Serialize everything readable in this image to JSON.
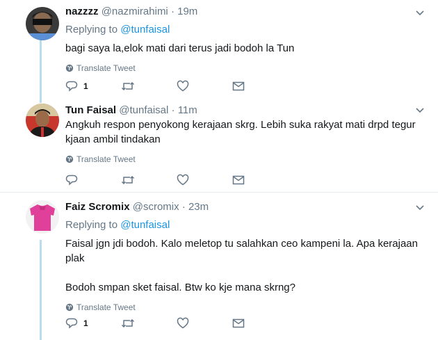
{
  "translate_label": "Translate Tweet",
  "replying_label": "Replying to",
  "tweets": [
    {
      "name": "nazzzz",
      "handle": "@nazmirahimi",
      "sep": "·",
      "time": "19m",
      "replying_to": "@tunfaisal",
      "lines": [
        "bagi saya la,elok mati dari terus jadi bodoh la Tun"
      ],
      "reply_count": "1"
    },
    {
      "name": "Tun Faisal",
      "handle": "@tunfaisal",
      "sep": "·",
      "time": "11m",
      "lines": [
        "Angkuh respon penyokong kerajaan skrg. Lebih suka rakyat mati drpd tegur",
        "kjaan ambil tindakan"
      ],
      "reply_count": ""
    },
    {
      "name": "Faiz Scromix",
      "handle": "@scromix",
      "sep": "·",
      "time": "23m",
      "replying_to": "@tunfaisal",
      "lines": [
        "Faisal jgn jdi bodoh. Kalo meletop tu salahkan ceo kampeni la. Apa kerajaan",
        "plak",
        "",
        "Bodoh smpan sket faisal. Btw ko kje mana skrng?"
      ],
      "reply_count": "1"
    }
  ],
  "colors": {
    "link": "#1b95e0",
    "muted": "#657786",
    "thread": "#b9dcf0",
    "pink_shirt": "#e0409a"
  }
}
